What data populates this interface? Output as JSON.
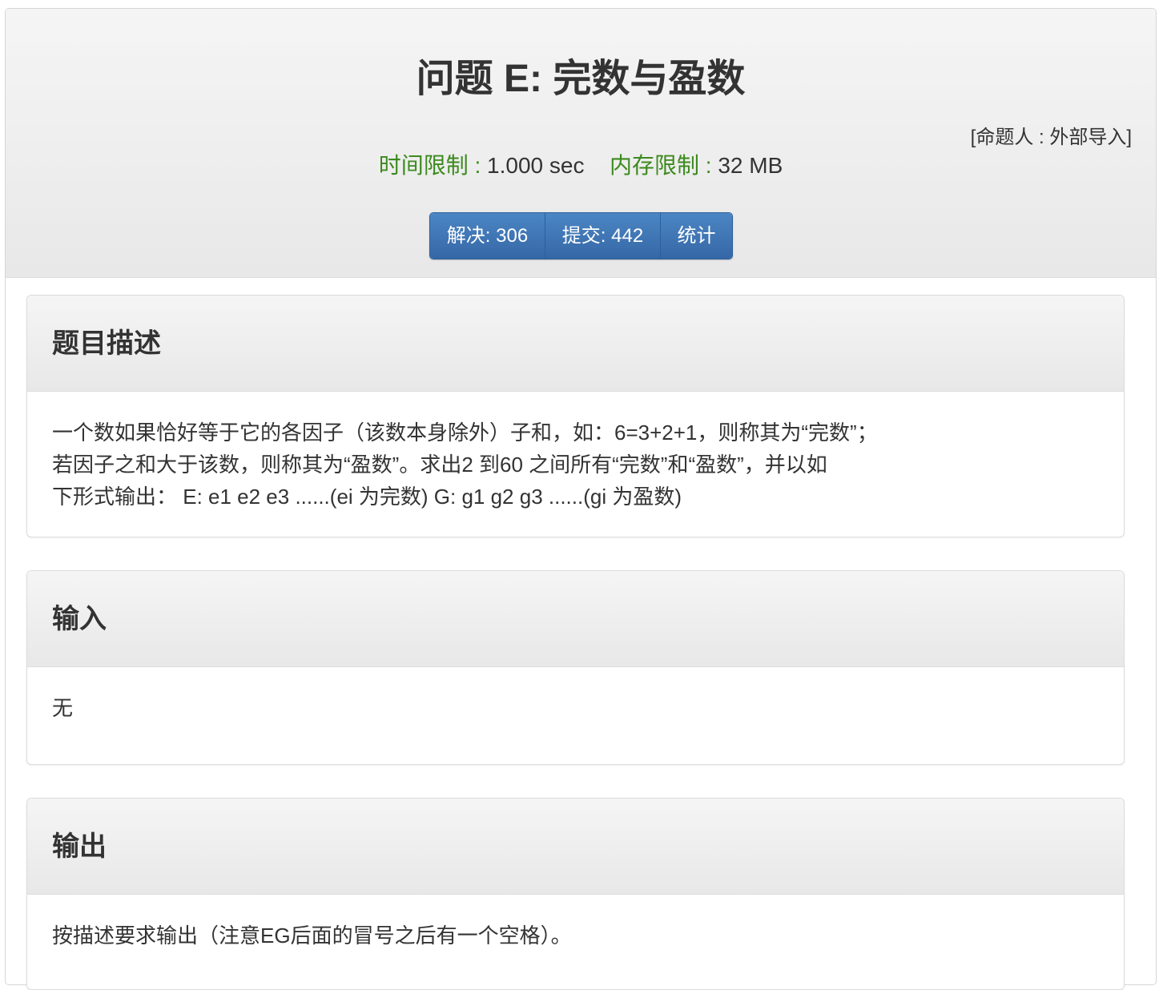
{
  "problem": {
    "title": "问题 E: 完数与盈数",
    "author": "[命题人 : 外部导入]",
    "time_limit_label": "时间限制 :",
    "time_limit_value": "1.000 sec",
    "memory_limit_label": "内存限制 :",
    "memory_limit_value": "32 MB"
  },
  "buttons": {
    "solved": "解决: 306",
    "submitted": "提交: 442",
    "stats": "统计"
  },
  "sections": {
    "description": {
      "heading": "题目描述",
      "lines": [
        "一个数如果恰好等于它的各因子（该数本身除外）子和，如：6=3+2+1，则称其为“完数”；",
        "若因子之和大于该数，则称其为“盈数”。求出2 到60 之间所有“完数”和“盈数”，并以如",
        "下形式输出：  E: e1 e2 e3 ......(ei 为完数) G: g1 g2 g3 ......(gi 为盈数)"
      ]
    },
    "input": {
      "heading": "输入",
      "text": "无"
    },
    "output": {
      "heading": "输出",
      "text": "按描述要求输出（注意EG后面的冒号之后有一个空格）。"
    }
  }
}
